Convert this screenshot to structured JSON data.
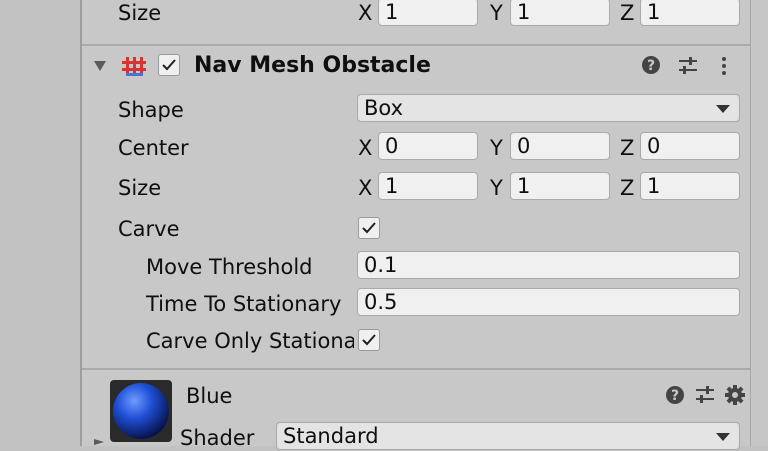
{
  "top_row": {
    "label": "Size",
    "x_axis": "X",
    "x": "1",
    "y_axis": "Y",
    "y": "1",
    "z_axis": "Z",
    "z": "1"
  },
  "nav_mesh": {
    "title": "Nav Mesh Obstacle",
    "enabled": true,
    "shape": {
      "label": "Shape",
      "value": "Box"
    },
    "center": {
      "label": "Center",
      "x_axis": "X",
      "x": "0",
      "y_axis": "Y",
      "y": "0",
      "z_axis": "Z",
      "z": "0"
    },
    "size": {
      "label": "Size",
      "x_axis": "X",
      "x": "1",
      "y_axis": "Y",
      "y": "1",
      "z_axis": "Z",
      "z": "1"
    },
    "carve": {
      "label": "Carve",
      "checked": true
    },
    "move_threshold": {
      "label": "Move Threshold",
      "value": "0.1"
    },
    "time_to_stationary": {
      "label": "Time To Stationary",
      "value": "0.5"
    },
    "carve_only_stationary": {
      "label": "Carve Only Stationa",
      "checked": true
    }
  },
  "material": {
    "name": "Blue",
    "color": "#1f4fd6",
    "shader": {
      "label": "Shader",
      "value": "Standard"
    }
  },
  "icons": [
    "foldout-arrow-icon",
    "nav-mesh-obstacle-icon",
    "help-icon",
    "presets-icon",
    "more-menu-icon",
    "dropdown-arrow-icon",
    "settings-gear-icon"
  ]
}
